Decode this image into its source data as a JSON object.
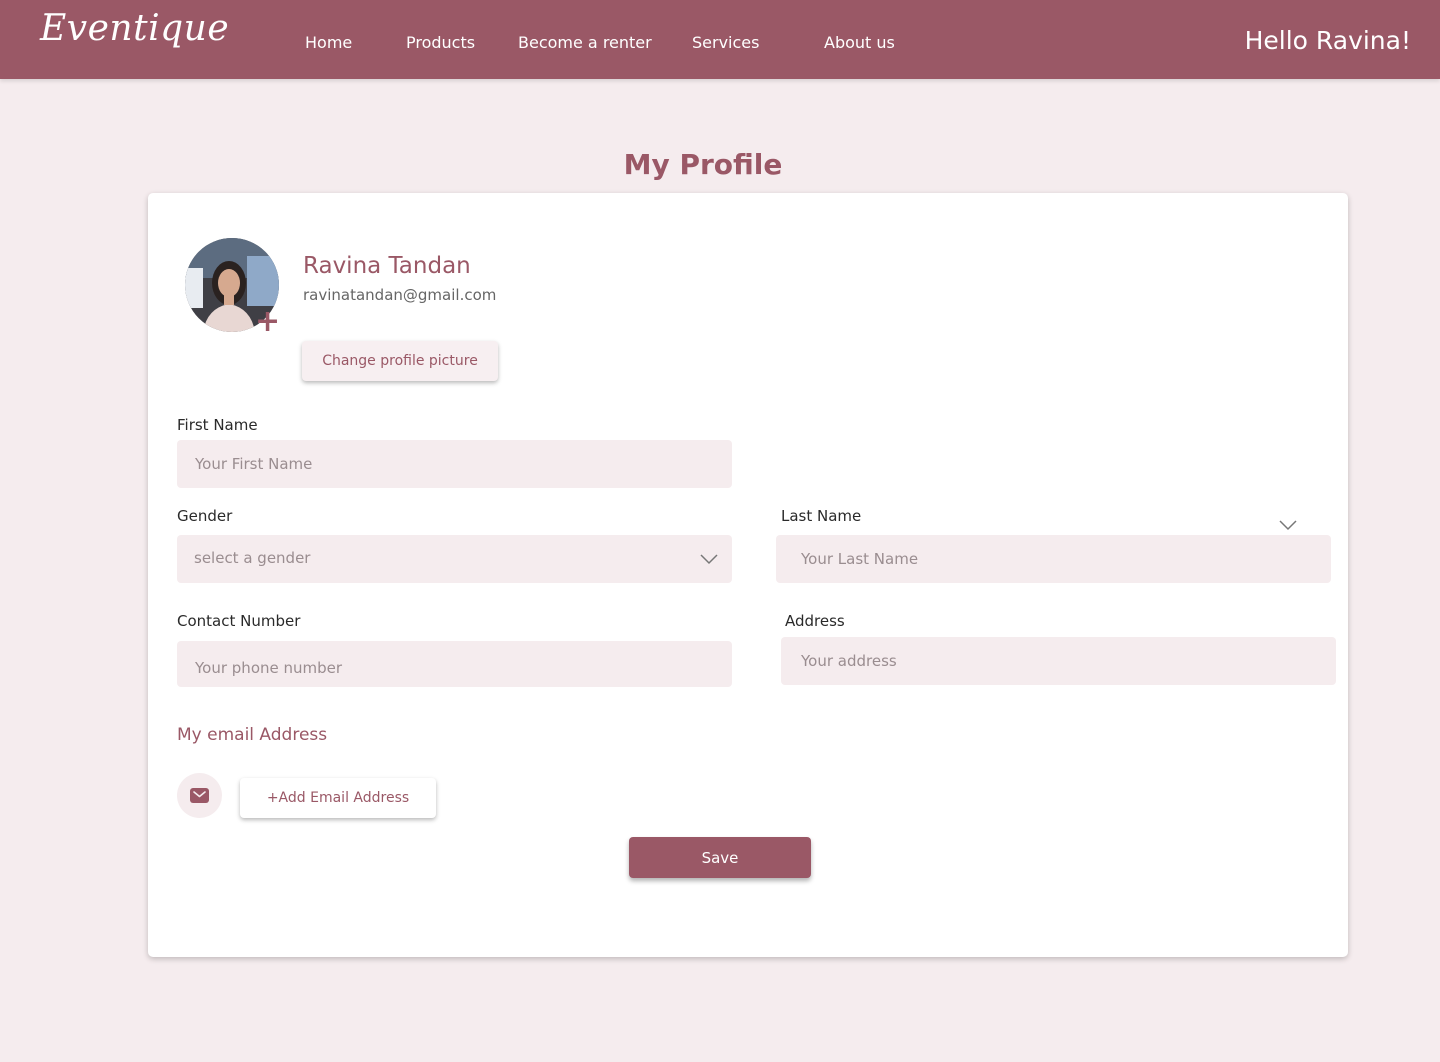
{
  "brand": {
    "logo_text": "Eventique"
  },
  "nav": {
    "links": [
      "Home",
      "Products",
      "Become a renter",
      "Services",
      "About us"
    ],
    "greeting": "Hello Ravina!"
  },
  "page": {
    "title": "My Profile"
  },
  "profile": {
    "name": "Ravina Tandan",
    "email": "ravinatandan@gmail.com",
    "change_picture_label": "Change profile picture",
    "avatar_icon": "user-photo",
    "add_photo_icon": "plus-icon"
  },
  "form": {
    "first_name": {
      "label": "First Name",
      "placeholder": "Your First Name"
    },
    "gender": {
      "label": "Gender",
      "placeholder": "select a gender"
    },
    "last_name": {
      "label": "Last Name",
      "placeholder": "Your Last Name"
    },
    "contact": {
      "label": "Contact Number",
      "placeholder": "Your phone number"
    },
    "address": {
      "label": "Address",
      "placeholder": "Your address"
    }
  },
  "email_section": {
    "title": "My email Address",
    "add_label": "+Add Email Address",
    "icon": "mail-icon"
  },
  "save_label": "Save",
  "colors": {
    "brand": "#9a5866",
    "background": "#f5ecee",
    "input_fill": "#f5ecee",
    "card": "#ffffff"
  }
}
